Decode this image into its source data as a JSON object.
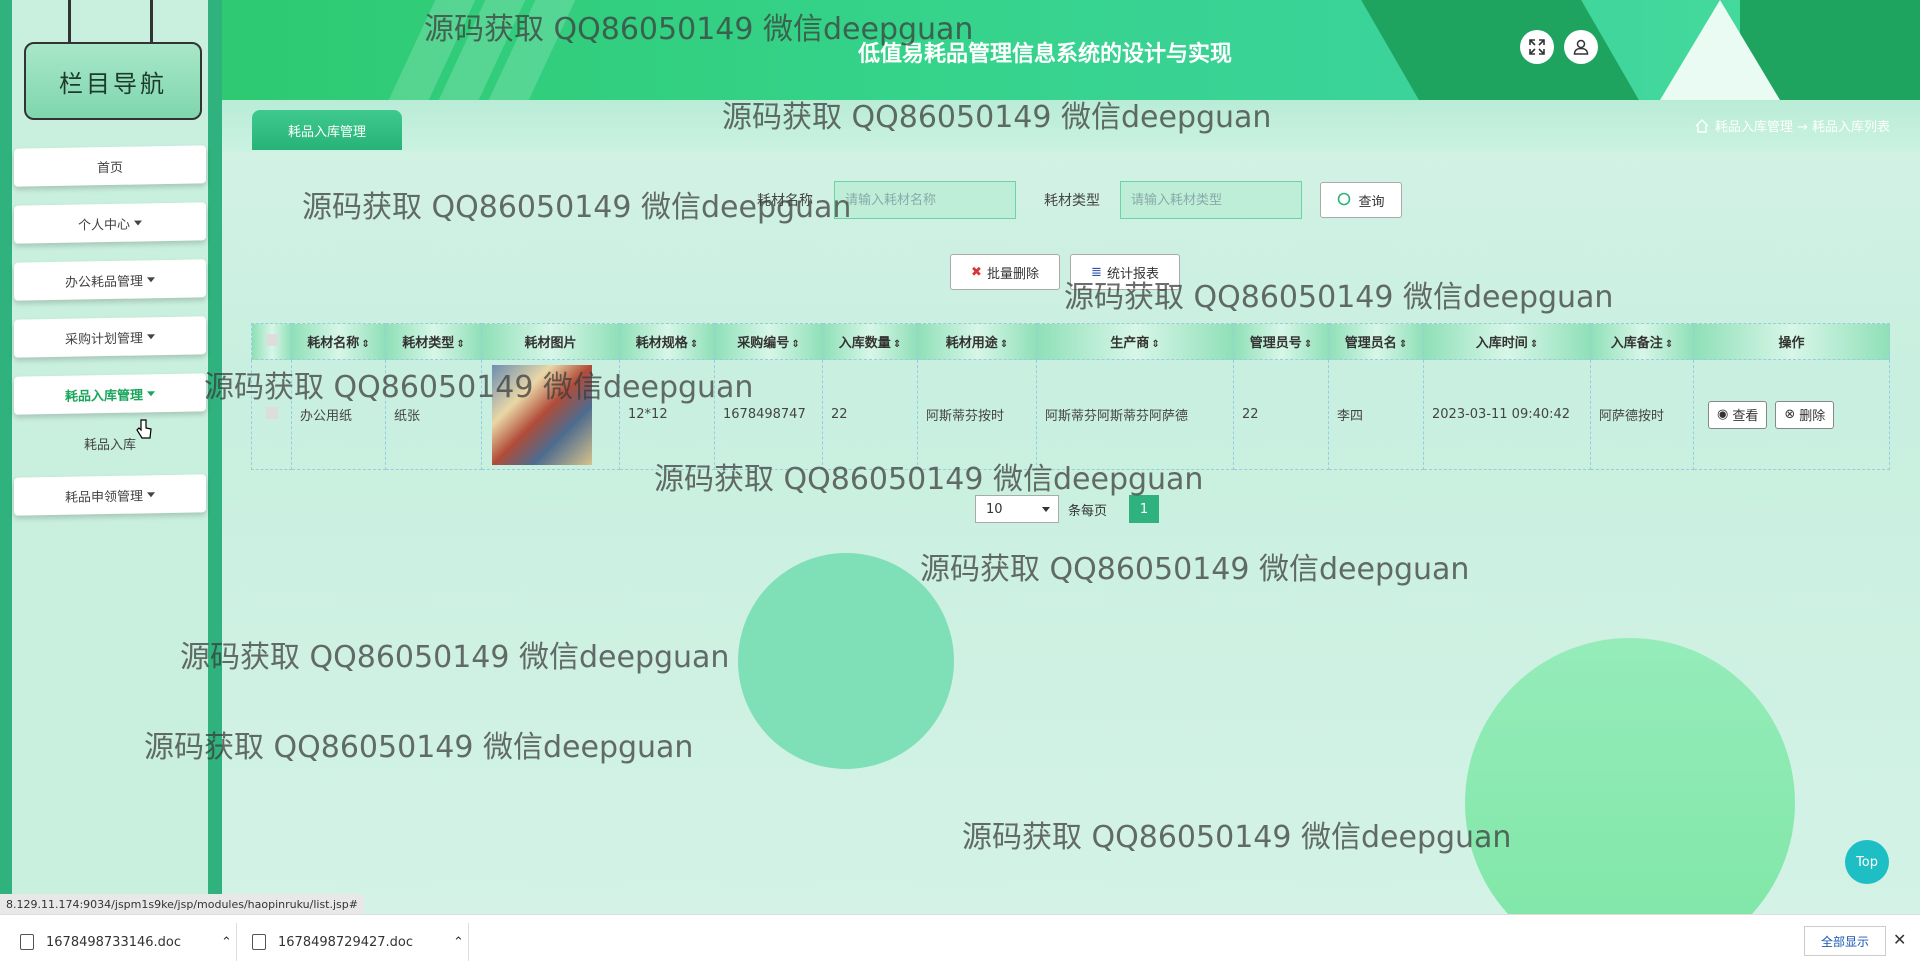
{
  "sidebar": {
    "title": "栏目导航",
    "items": [
      {
        "label": "首页",
        "has_caret": false
      },
      {
        "label": "个人中心",
        "has_caret": true
      },
      {
        "label": "办公耗品管理",
        "has_caret": true
      },
      {
        "label": "采购计划管理",
        "has_caret": true
      },
      {
        "label": "耗品入库管理",
        "has_caret": true,
        "active": true
      },
      {
        "label": "耗品申领管理",
        "has_caret": true
      }
    ],
    "submenu": [
      "耗品入库"
    ]
  },
  "header": {
    "title": "低值易耗品管理信息系统的设计与实现",
    "fullscreen_icon": "fullscreen-icon",
    "user_icon": "user-icon"
  },
  "tabs": {
    "active": "耗品入库管理"
  },
  "breadcrumb": {
    "home_icon": "home-icon",
    "text": "耗品入库管理 → 耗品入库列表"
  },
  "search": {
    "name_label": "耗材名称",
    "name_placeholder": "请输入耗材名称",
    "type_label": "耗材类型",
    "type_placeholder": "请输入耗材类型",
    "query_button": "查询"
  },
  "actions": {
    "batch_delete": "批量删除",
    "report": "统计报表"
  },
  "table": {
    "columns": [
      "耗材名称",
      "耗材类型",
      "耗材图片",
      "耗材规格",
      "采购编号",
      "入库数量",
      "耗材用途",
      "生产商",
      "管理员号",
      "管理员名",
      "入库时间",
      "入库备注",
      "操作"
    ],
    "rows": [
      {
        "name": "办公用纸",
        "type": "纸张",
        "spec": "12*12",
        "purchase_no": "1678498747",
        "quantity": "22",
        "purpose": "阿斯蒂芬按时",
        "manufacturer": "阿斯蒂芬阿斯蒂芬阿萨德",
        "admin_no": "22",
        "admin_name": "李四",
        "time": "2023-03-11 09:40:42",
        "remark": "阿萨德按时",
        "view": "查看",
        "delete": "删除"
      }
    ]
  },
  "pagination": {
    "page_size": "10",
    "per_page_label": "条每页",
    "current_page": "1"
  },
  "watermark": "源码获取 QQ86050149 微信deepguan",
  "top_button": "Top",
  "status_url": "8.129.11.174:9034/jspm1s9ke/jsp/modules/haopinruku/list.jsp#",
  "downloads": [
    {
      "name": "1678498733146.doc"
    },
    {
      "name": "1678498729427.doc"
    }
  ],
  "show_all": "全部显示",
  "colors": {
    "primary": "#2fb27e",
    "header": "#35d38a",
    "top_button": "#1dbfc5"
  }
}
